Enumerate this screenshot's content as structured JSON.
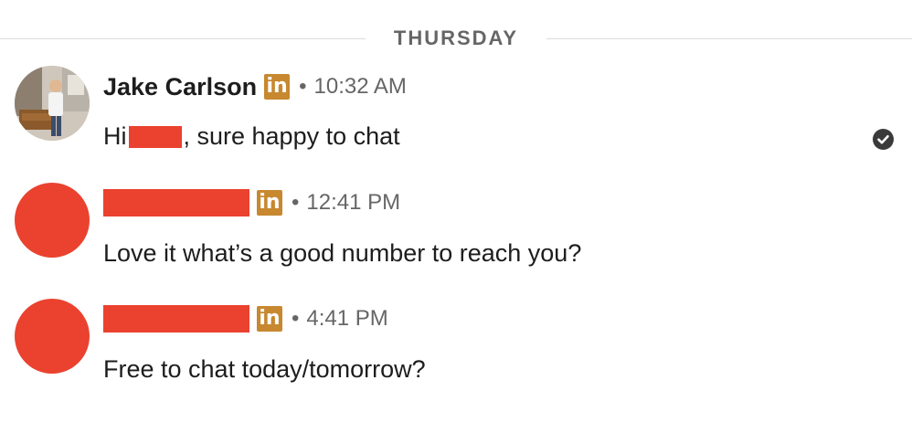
{
  "divider": {
    "label": "THURSDAY"
  },
  "linkedin_badge": "in",
  "separator": "•",
  "messages": [
    {
      "sender": "Jake Carlson",
      "time": "10:32 AM",
      "text_prefix": "Hi",
      "text_suffix": ", sure happy to chat",
      "read": true
    },
    {
      "sender": "",
      "time": "12:41 PM",
      "text": "Love it what’s a good number to reach you?"
    },
    {
      "sender": "",
      "time": "4:41 PM",
      "text": "Free to chat today/tomorrow?"
    }
  ],
  "colors": {
    "redaction": "#ea422f",
    "linkedin_badge": "#c7882f",
    "muted_text": "#666666"
  },
  "icons": {
    "read_receipt": "check-circle-icon",
    "linkedin": "linkedin-icon"
  }
}
